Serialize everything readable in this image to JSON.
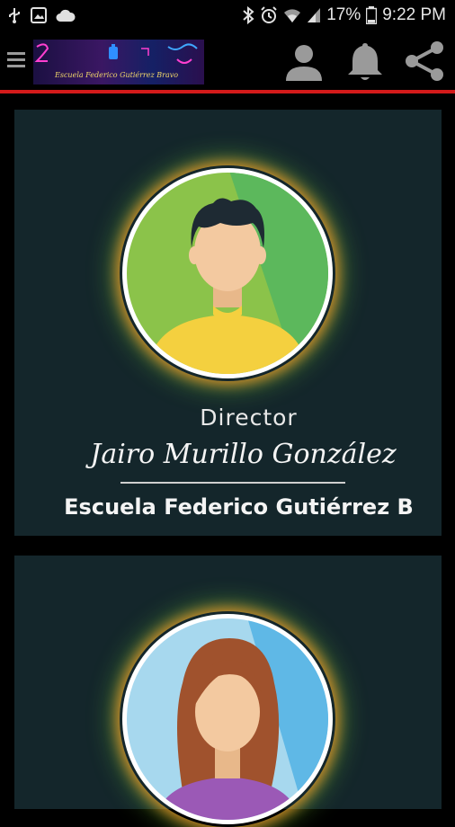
{
  "status_bar": {
    "battery_percent": "17%",
    "time": "9:22 PM",
    "icons_left": [
      "usb-icon",
      "image-icon",
      "cloud-icon"
    ],
    "icons_right": [
      "bluetooth-icon",
      "alarm-icon",
      "wifi-icon",
      "signal-icon",
      "battery-icon"
    ]
  },
  "app_bar": {
    "banner_text": "Escuela Federico Gutiérrez Bravo",
    "actions": [
      "profile-icon",
      "notifications-icon",
      "share-icon"
    ],
    "accent_color": "#d41a1a"
  },
  "cards": [
    {
      "role": "Director",
      "name": "Jairo Murillo González",
      "school": "Escuela Federico  Gutiérrez B",
      "avatar": "male-avatar"
    },
    {
      "avatar": "female-avatar"
    }
  ]
}
